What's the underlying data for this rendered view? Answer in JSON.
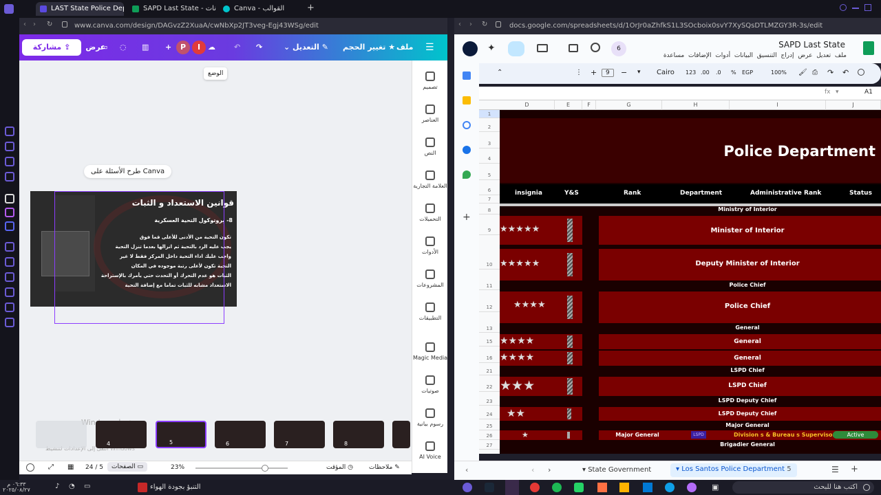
{
  "browser": {
    "tabs": [
      {
        "label": "LAST State Police Departm",
        "color": "#5b4ae0",
        "active": true
      },
      {
        "label": "SAPD Last State - ل بيانات",
        "color": "#0f9d58",
        "active": false
      },
      {
        "label": "Canva - القوالب",
        "color": "#00c4cc",
        "active": false
      }
    ],
    "new_tab": "+"
  },
  "canva": {
    "url": "www.canva.com/design/DAGvzZ2XuaA/cwNbXp2JT3veg-Egj43WSg/edit",
    "topbar": {
      "menu": "☰",
      "file": "ملف",
      "resize": "تغيير الحجم",
      "edit": "التعديل",
      "present": "عرض",
      "share": "مشاركة",
      "avatar1": "P",
      "avatar2": "I"
    },
    "tooltip": "الوضع",
    "ask_canva": "طرح الأسئلة على Canva",
    "sidebar": [
      {
        "label": "تصميم"
      },
      {
        "label": "العناصر"
      },
      {
        "label": "النص"
      },
      {
        "label": "العلامة التجارية"
      },
      {
        "label": "التحميلات"
      },
      {
        "label": "الأدوات"
      },
      {
        "label": "المشروعات"
      },
      {
        "label": "التطبيقات"
      },
      {
        "label": "Magic Media"
      },
      {
        "label": "صوتيات"
      },
      {
        "label": "رسوم بيانية"
      },
      {
        "label": "AI Voice"
      }
    ],
    "slide": {
      "title": "قوانين الاستعداد و الثبات",
      "subtitle": "8- بروتوكول التحية العسكرية",
      "lines": [
        "تكون التحية من الأدنى للأعلى قما فوق",
        "يجب عليه الرد بالتحية ثم انزالها بعدما تنزل التحية",
        "واجب عليك اداء التحية داخل المركز فقط لا غير",
        "التحية تكون لأعلى رتبة موجوده في المكان",
        "الثبات هو عدم التحرك أو التحدث حتي يأمرك بالإستراحة",
        "الاستعداد مشابه للثبات تماما مع إضافة التحية"
      ]
    },
    "thumbs": [
      {
        "num": "4"
      },
      {
        "num": "5"
      },
      {
        "num": "6"
      },
      {
        "num": "7"
      },
      {
        "num": "8"
      }
    ],
    "bottom": {
      "notes": "ملاحظات",
      "timer": "المؤقت",
      "zoom": "23%",
      "pages": "الصفحات",
      "page_count": "24 / 5"
    },
    "watermark": "Windows تنشيط",
    "watermark2": "انتقل إلى الإعدادات لتنشيط Windows"
  },
  "sheets": {
    "url": "docs.google.com/spreadsheets/d/1OrJr0aZhfkS1L3SOcboix0svY7XySQsDTLMZGY3R-3s/edit",
    "title": "SAPD Last State",
    "menu": [
      "ملف",
      "تعديل",
      "عرض",
      "إدراج",
      "التنسيق",
      "البيانات",
      "أدوات",
      "الإضافات",
      "مساعدة"
    ],
    "toolbar": {
      "zoom": "100%",
      "currency": "EGP",
      "percent": "%",
      "dec1": ".0",
      "dec2": ".00",
      "num": "123",
      "font": "Cairo",
      "size": "9"
    },
    "cell_ref": "A1",
    "badge": "6",
    "columns": [
      {
        "label": "D"
      },
      {
        "label": "E"
      },
      {
        "label": "F"
      },
      {
        "label": "G"
      },
      {
        "label": "H"
      },
      {
        "label": "I"
      },
      {
        "label": "J"
      }
    ],
    "header_title": "Police Department",
    "header_cols": {
      "insignia": "insignia",
      "ys": "Y&S",
      "rank": "Rank",
      "department": "Department",
      "admin_rank": "Administrative Rank",
      "status": "Status"
    },
    "rows": [
      {
        "num": "1"
      },
      {
        "num": "2"
      },
      {
        "num": "3"
      },
      {
        "num": "4"
      },
      {
        "num": "5"
      },
      {
        "num": "6"
      },
      {
        "num": "7"
      },
      {
        "num": "8",
        "label": "Ministry of Interior"
      },
      {
        "num": "9",
        "label": "Minister of Interior",
        "stars": "★★★★★"
      },
      {
        "num": "10",
        "label": "Deputy Minister of Interior",
        "stars": "★★★★★"
      },
      {
        "num": "11",
        "label": "Police Chief"
      },
      {
        "num": "12",
        "label": "Police Chief",
        "stars": "★★★★"
      },
      {
        "num": "13",
        "label": "General"
      },
      {
        "num": "15",
        "label": "General",
        "stars": "★★★★"
      },
      {
        "num": "16",
        "label": "General",
        "stars": "★★★★"
      },
      {
        "num": "21",
        "label": "LSPD Chief"
      },
      {
        "num": "22",
        "label": "LSPD Chief",
        "stars": "★★★"
      },
      {
        "num": "23",
        "label": "LSPD Deputy Chief"
      },
      {
        "num": "24",
        "label": "LSPD Deputy Chief",
        "stars": "★★"
      },
      {
        "num": "25",
        "label": "Major General"
      },
      {
        "num": "26",
        "rank": "Major General",
        "dept": "Division s & Bureau s Supervisor",
        "status": "Active",
        "dept_tag": "LSPD",
        "stars": "★"
      },
      {
        "num": "27",
        "label": "Brigadier General"
      }
    ],
    "sheet_tabs": {
      "tab1": "State Government",
      "tab2": "Los Santos Police Department",
      "count": "5"
    }
  },
  "taskbar": {
    "weather": "التنبؤ بجودة الهواء",
    "search": "اكتب هنا للبحث",
    "time": "٠٦:٣٣ م",
    "date": "٢٠٢٥/٠٨/٢٧"
  }
}
